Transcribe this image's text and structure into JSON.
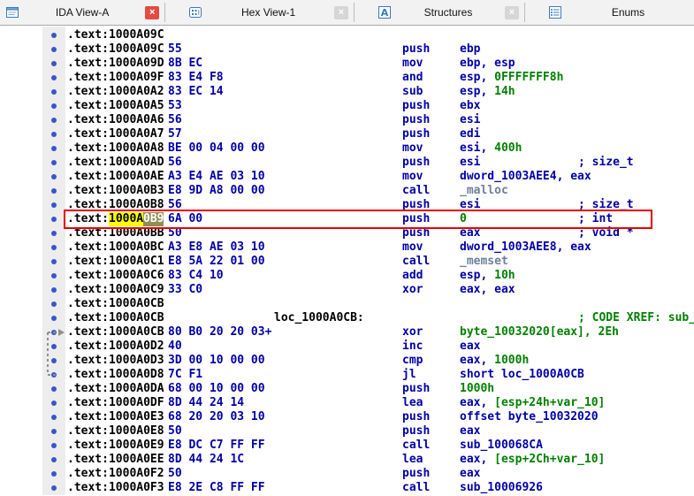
{
  "tabs": [
    {
      "label": "IDA View-A",
      "icon": "ida-view-icon",
      "active": true,
      "closable": true
    },
    {
      "label": "Hex View-1",
      "icon": "hex-view-icon",
      "active": false,
      "closable": true
    },
    {
      "label": "Structures",
      "icon": "structures-icon",
      "active": false,
      "closable": true
    },
    {
      "label": "Enums",
      "icon": "enums-icon",
      "active": false,
      "closable": false
    }
  ],
  "ui": {
    "close_glyph": "×"
  },
  "icons": {
    "tab_icon_names": [
      "ida-view-icon",
      "hex-view-icon",
      "structures-icon",
      "enums-icon"
    ],
    "structures_glyph": "A",
    "line_marker": "blue-dot"
  },
  "colors": {
    "address": "#000000",
    "code": "#0000a8",
    "number": "#008000",
    "library_function": "#6d7f9d",
    "comment": "#0000a8",
    "xref_comment": "#008000",
    "highlight_yellow": "#ffff00",
    "cursor_olive": "#8f8f58",
    "box_red": "#e60000",
    "dot_blue": "#3a55c8"
  },
  "listing": {
    "rows": [
      {
        "addr": ".text:1000A09C"
      },
      {
        "addr": ".text:1000A09C",
        "bytes": "55",
        "mn": "push",
        "ops": [
          [
            "ebp",
            "c"
          ]
        ]
      },
      {
        "addr": ".text:1000A09D",
        "bytes": "8B EC",
        "mn": "mov",
        "ops": [
          [
            "ebp, esp",
            "c"
          ]
        ]
      },
      {
        "addr": ".text:1000A09F",
        "bytes": "83 E4 F8",
        "mn": "and",
        "ops": [
          [
            "esp, ",
            "c"
          ],
          [
            "0FFFFFFF8h",
            "n"
          ]
        ]
      },
      {
        "addr": ".text:1000A0A2",
        "bytes": "83 EC 14",
        "mn": "sub",
        "ops": [
          [
            "esp, ",
            "c"
          ],
          [
            "14h",
            "n"
          ]
        ]
      },
      {
        "addr": ".text:1000A0A5",
        "bytes": "53",
        "mn": "push",
        "ops": [
          [
            "ebx",
            "c"
          ]
        ]
      },
      {
        "addr": ".text:1000A0A6",
        "bytes": "56",
        "mn": "push",
        "ops": [
          [
            "esi",
            "c"
          ]
        ]
      },
      {
        "addr": ".text:1000A0A7",
        "bytes": "57",
        "mn": "push",
        "ops": [
          [
            "edi",
            "c"
          ]
        ]
      },
      {
        "addr": ".text:1000A0A8",
        "bytes": "BE 00 04 00 00",
        "mn": "mov",
        "ops": [
          [
            "esi, ",
            "c"
          ],
          [
            "400h",
            "n"
          ]
        ]
      },
      {
        "addr": ".text:1000A0AD",
        "bytes": "56",
        "mn": "push",
        "ops": [
          [
            "esi",
            "c"
          ]
        ],
        "cmt": {
          "t": "; size_t",
          "c": "b"
        }
      },
      {
        "addr": ".text:1000A0AE",
        "bytes": "A3 E4 AE 03 10",
        "mn": "mov",
        "ops": [
          [
            "dword_1003AEE4, eax",
            "c"
          ]
        ]
      },
      {
        "addr": ".text:1000A0B3",
        "bytes": "E8 9D A8 00 00",
        "mn": "call",
        "ops": [
          [
            "_malloc",
            "l"
          ]
        ]
      },
      {
        "addr": ".text:1000A0B8",
        "bytes": "56",
        "mn": "push",
        "ops": [
          [
            "esi",
            "c"
          ]
        ],
        "cmt": {
          "t": "; size_t",
          "c": "b"
        }
      },
      {
        "sel": {
          "pre": ".text:",
          "hl": "1000A",
          "cur": "0B9"
        },
        "bytes": "6A 00",
        "mn": "push",
        "ops": [
          [
            "0",
            "n"
          ]
        ],
        "cmt": {
          "t": "; int",
          "c": "b"
        },
        "boxed": true
      },
      {
        "addr": ".text:1000A0BB",
        "bytes": "50",
        "mn": "push",
        "ops": [
          [
            "eax",
            "c"
          ]
        ],
        "cmt": {
          "t": "; void *",
          "c": "b"
        }
      },
      {
        "addr": ".text:1000A0BC",
        "bytes": "A3 E8 AE 03 10",
        "mn": "mov",
        "ops": [
          [
            "dword_1003AEE8, eax",
            "c"
          ]
        ]
      },
      {
        "addr": ".text:1000A0C1",
        "bytes": "E8 5A 22 01 00",
        "mn": "call",
        "ops": [
          [
            "_memset",
            "l"
          ]
        ]
      },
      {
        "addr": ".text:1000A0C6",
        "bytes": "83 C4 10",
        "mn": "add",
        "ops": [
          [
            "esp, ",
            "c"
          ],
          [
            "10h",
            "n"
          ]
        ]
      },
      {
        "addr": ".text:1000A0C9",
        "bytes": "33 C0",
        "mn": "xor",
        "ops": [
          [
            "eax, eax",
            "c"
          ]
        ]
      },
      {
        "addr": ".text:1000A0CB"
      },
      {
        "addr": ".text:1000A0CB",
        "label": "loc_1000A0CB:",
        "cmt": {
          "t": "; CODE XREF: sub_",
          "c": "g"
        }
      },
      {
        "addr": ".text:1000A0CB",
        "bytes": "80 B0 20 20 03+",
        "mn": "xor",
        "ops": [
          [
            "byte_10032020[eax], 2Eh",
            "n"
          ]
        ]
      },
      {
        "addr": ".text:1000A0D2",
        "bytes": "40",
        "mn": "inc",
        "ops": [
          [
            "eax",
            "c"
          ]
        ]
      },
      {
        "addr": ".text:1000A0D3",
        "bytes": "3D 00 10 00 00",
        "mn": "cmp",
        "ops": [
          [
            "eax, ",
            "c"
          ],
          [
            "1000h",
            "n"
          ]
        ]
      },
      {
        "addr": ".text:1000A0D8",
        "bytes": "7C F1",
        "mn": "jl",
        "ops": [
          [
            "short loc_1000A0CB",
            "c"
          ]
        ]
      },
      {
        "addr": ".text:1000A0DA",
        "bytes": "68 00 10 00 00",
        "mn": "push",
        "ops": [
          [
            "1000h",
            "n"
          ]
        ]
      },
      {
        "addr": ".text:1000A0DF",
        "bytes": "8D 44 24 14",
        "mn": "lea",
        "ops": [
          [
            "eax, ",
            "c"
          ],
          [
            "[esp+24h+var_10]",
            "n"
          ]
        ]
      },
      {
        "addr": ".text:1000A0E3",
        "bytes": "68 20 20 03 10",
        "mn": "push",
        "ops": [
          [
            "offset byte_10032020",
            "c"
          ]
        ]
      },
      {
        "addr": ".text:1000A0E8",
        "bytes": "50",
        "mn": "push",
        "ops": [
          [
            "eax",
            "c"
          ]
        ]
      },
      {
        "addr": ".text:1000A0E9",
        "bytes": "E8 DC C7 FF FF",
        "mn": "call",
        "ops": [
          [
            "sub_100068CA",
            "c"
          ]
        ]
      },
      {
        "addr": ".text:1000A0EE",
        "bytes": "8D 44 24 1C",
        "mn": "lea",
        "ops": [
          [
            "eax, ",
            "c"
          ],
          [
            "[esp+2Ch+var_10]",
            "n"
          ]
        ]
      },
      {
        "addr": ".text:1000A0F2",
        "bytes": "50",
        "mn": "push",
        "ops": [
          [
            "eax",
            "c"
          ]
        ]
      },
      {
        "addr": ".text:1000A0F3",
        "bytes": "E8 2E C8 FF FF",
        "mn": "call",
        "ops": [
          [
            "sub_10006926",
            "c"
          ]
        ]
      }
    ]
  }
}
